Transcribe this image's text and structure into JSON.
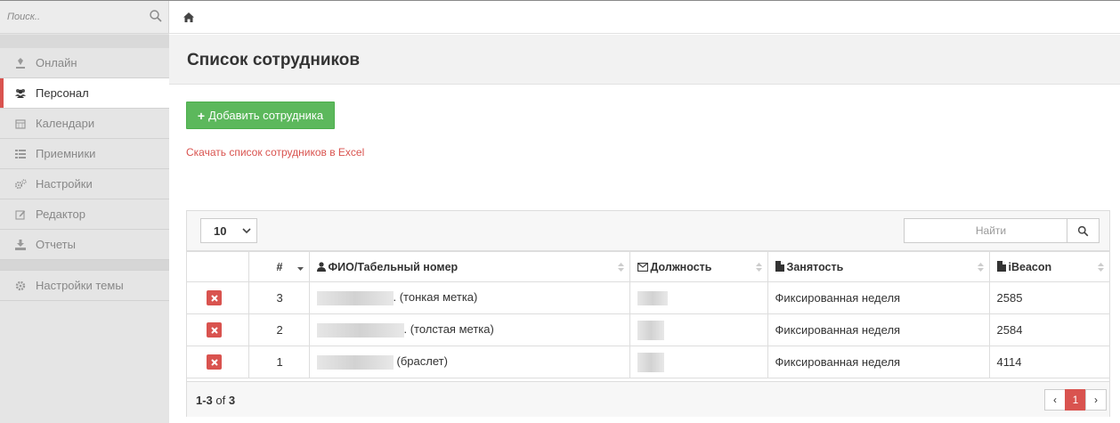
{
  "sidebar": {
    "search_placeholder": "Поиск..",
    "items": [
      {
        "label": "Онлайн",
        "icon": "map-marker-icon",
        "active": false
      },
      {
        "label": "Персонал",
        "icon": "users-icon",
        "active": true
      },
      {
        "label": "Календари",
        "icon": "calendar-icon",
        "active": false
      },
      {
        "label": "Приемники",
        "icon": "list-icon",
        "active": false
      },
      {
        "label": "Настройки",
        "icon": "cogs-icon",
        "active": false
      },
      {
        "label": "Редактор",
        "icon": "edit-icon",
        "active": false
      },
      {
        "label": "Отчеты",
        "icon": "download-icon",
        "active": false
      }
    ],
    "theme_settings": {
      "label": "Настройки темы",
      "icon": "gear-icon"
    }
  },
  "breadcrumb": {
    "icon": "home-icon"
  },
  "page": {
    "title": "Список сотрудников",
    "add_button": "Добавить сотрудника",
    "excel_link": "Скачать список сотрудников в Excel"
  },
  "table": {
    "page_size": "10",
    "search_placeholder": "Найти",
    "columns": [
      "#",
      "ФИО/Табельный номер",
      "Должность",
      "Занятость",
      "iBeacon"
    ],
    "rows": [
      {
        "num": "3",
        "name_suffix": ". (тонкая метка)",
        "employment": "Фиксированная неделя",
        "ibeacon": "2585"
      },
      {
        "num": "2",
        "name_suffix": ". (толстая метка)",
        "employment": "Фиксированная неделя",
        "ibeacon": "2584"
      },
      {
        "num": "1",
        "name_suffix": "(браслет)",
        "employment": "Фиксированная неделя",
        "ibeacon": "4114"
      }
    ],
    "footer": {
      "range": "1-3",
      "of": "of",
      "total": "3"
    },
    "pagination": {
      "prev": "‹",
      "current": "1",
      "next": "›"
    }
  },
  "colors": {
    "accent": "#d9534f",
    "success": "#5cb85c"
  }
}
